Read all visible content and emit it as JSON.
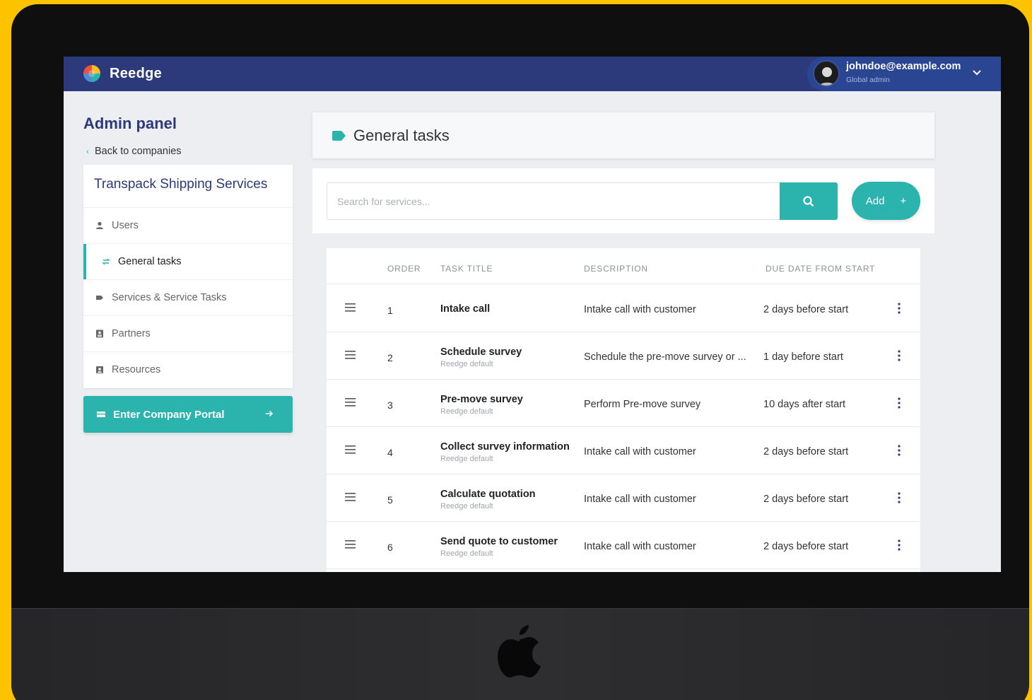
{
  "app": {
    "name": "Reedge"
  },
  "user": {
    "email": "johndoe@example.com",
    "role": "Global admin"
  },
  "sidebar": {
    "title": "Admin panel",
    "back_label": "Back to companies",
    "company": "Transpack Shipping Services",
    "items": [
      {
        "label": "Users",
        "icon": "user-icon"
      },
      {
        "label": "General tasks",
        "icon": "sync-icon",
        "active": true
      },
      {
        "label": "Services & Service Tasks",
        "icon": "tag-icon"
      },
      {
        "label": "Partners",
        "icon": "contact-card-icon"
      },
      {
        "label": "Resources",
        "icon": "resource-icon"
      }
    ],
    "portal_button": "Enter Company Portal"
  },
  "main": {
    "title": "General tasks",
    "search": {
      "placeholder": "Search for services..."
    },
    "add_label": "Add",
    "table": {
      "headers": [
        "ORDER",
        "TASK TITLE",
        "DESCRIPTION",
        "DUE DATE FROM START"
      ],
      "rows": [
        {
          "order": "1",
          "title": "Intake call",
          "sub": "",
          "description": "Intake call with customer",
          "due": "2 days before start"
        },
        {
          "order": "2",
          "title": "Schedule survey",
          "sub": "Reedge default",
          "description": "Schedule the pre-move survey or ...",
          "due": "1 day before start"
        },
        {
          "order": "3",
          "title": "Pre-move survey",
          "sub": "Reedge default",
          "description": "Perform Pre-move survey",
          "due": "10 days after start"
        },
        {
          "order": "4",
          "title": "Collect survey information",
          "sub": "Reedge default",
          "description": "Intake call with customer",
          "due": "2 days before start"
        },
        {
          "order": "5",
          "title": "Calculate quotation",
          "sub": "Reedge default",
          "description": "Intake call with customer",
          "due": "2 days before start"
        },
        {
          "order": "6",
          "title": "Send quote to customer",
          "sub": "Reedge default",
          "description": "Intake call with customer",
          "due": "2 days before start"
        }
      ]
    }
  },
  "colors": {
    "accent": "#2bb3ad",
    "navbar": "#2c3a7c",
    "background": "#FDC300"
  }
}
